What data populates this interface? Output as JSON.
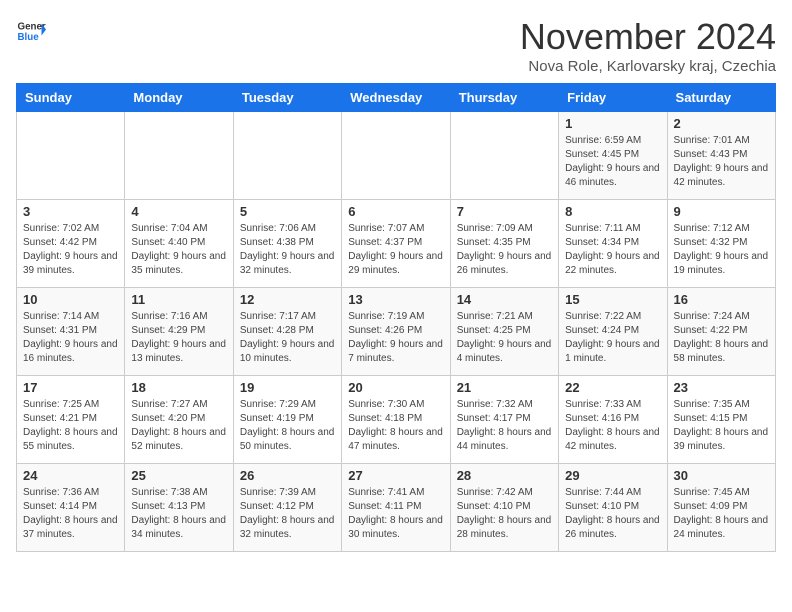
{
  "logo": {
    "line1": "General",
    "line2": "Blue"
  },
  "title": "November 2024",
  "subtitle": "Nova Role, Karlovarsky kraj, Czechia",
  "days_of_week": [
    "Sunday",
    "Monday",
    "Tuesday",
    "Wednesday",
    "Thursday",
    "Friday",
    "Saturday"
  ],
  "weeks": [
    [
      {
        "day": "",
        "info": ""
      },
      {
        "day": "",
        "info": ""
      },
      {
        "day": "",
        "info": ""
      },
      {
        "day": "",
        "info": ""
      },
      {
        "day": "",
        "info": ""
      },
      {
        "day": "1",
        "info": "Sunrise: 6:59 AM\nSunset: 4:45 PM\nDaylight: 9 hours and 46 minutes."
      },
      {
        "day": "2",
        "info": "Sunrise: 7:01 AM\nSunset: 4:43 PM\nDaylight: 9 hours and 42 minutes."
      }
    ],
    [
      {
        "day": "3",
        "info": "Sunrise: 7:02 AM\nSunset: 4:42 PM\nDaylight: 9 hours and 39 minutes."
      },
      {
        "day": "4",
        "info": "Sunrise: 7:04 AM\nSunset: 4:40 PM\nDaylight: 9 hours and 35 minutes."
      },
      {
        "day": "5",
        "info": "Sunrise: 7:06 AM\nSunset: 4:38 PM\nDaylight: 9 hours and 32 minutes."
      },
      {
        "day": "6",
        "info": "Sunrise: 7:07 AM\nSunset: 4:37 PM\nDaylight: 9 hours and 29 minutes."
      },
      {
        "day": "7",
        "info": "Sunrise: 7:09 AM\nSunset: 4:35 PM\nDaylight: 9 hours and 26 minutes."
      },
      {
        "day": "8",
        "info": "Sunrise: 7:11 AM\nSunset: 4:34 PM\nDaylight: 9 hours and 22 minutes."
      },
      {
        "day": "9",
        "info": "Sunrise: 7:12 AM\nSunset: 4:32 PM\nDaylight: 9 hours and 19 minutes."
      }
    ],
    [
      {
        "day": "10",
        "info": "Sunrise: 7:14 AM\nSunset: 4:31 PM\nDaylight: 9 hours and 16 minutes."
      },
      {
        "day": "11",
        "info": "Sunrise: 7:16 AM\nSunset: 4:29 PM\nDaylight: 9 hours and 13 minutes."
      },
      {
        "day": "12",
        "info": "Sunrise: 7:17 AM\nSunset: 4:28 PM\nDaylight: 9 hours and 10 minutes."
      },
      {
        "day": "13",
        "info": "Sunrise: 7:19 AM\nSunset: 4:26 PM\nDaylight: 9 hours and 7 minutes."
      },
      {
        "day": "14",
        "info": "Sunrise: 7:21 AM\nSunset: 4:25 PM\nDaylight: 9 hours and 4 minutes."
      },
      {
        "day": "15",
        "info": "Sunrise: 7:22 AM\nSunset: 4:24 PM\nDaylight: 9 hours and 1 minute."
      },
      {
        "day": "16",
        "info": "Sunrise: 7:24 AM\nSunset: 4:22 PM\nDaylight: 8 hours and 58 minutes."
      }
    ],
    [
      {
        "day": "17",
        "info": "Sunrise: 7:25 AM\nSunset: 4:21 PM\nDaylight: 8 hours and 55 minutes."
      },
      {
        "day": "18",
        "info": "Sunrise: 7:27 AM\nSunset: 4:20 PM\nDaylight: 8 hours and 52 minutes."
      },
      {
        "day": "19",
        "info": "Sunrise: 7:29 AM\nSunset: 4:19 PM\nDaylight: 8 hours and 50 minutes."
      },
      {
        "day": "20",
        "info": "Sunrise: 7:30 AM\nSunset: 4:18 PM\nDaylight: 8 hours and 47 minutes."
      },
      {
        "day": "21",
        "info": "Sunrise: 7:32 AM\nSunset: 4:17 PM\nDaylight: 8 hours and 44 minutes."
      },
      {
        "day": "22",
        "info": "Sunrise: 7:33 AM\nSunset: 4:16 PM\nDaylight: 8 hours and 42 minutes."
      },
      {
        "day": "23",
        "info": "Sunrise: 7:35 AM\nSunset: 4:15 PM\nDaylight: 8 hours and 39 minutes."
      }
    ],
    [
      {
        "day": "24",
        "info": "Sunrise: 7:36 AM\nSunset: 4:14 PM\nDaylight: 8 hours and 37 minutes."
      },
      {
        "day": "25",
        "info": "Sunrise: 7:38 AM\nSunset: 4:13 PM\nDaylight: 8 hours and 34 minutes."
      },
      {
        "day": "26",
        "info": "Sunrise: 7:39 AM\nSunset: 4:12 PM\nDaylight: 8 hours and 32 minutes."
      },
      {
        "day": "27",
        "info": "Sunrise: 7:41 AM\nSunset: 4:11 PM\nDaylight: 8 hours and 30 minutes."
      },
      {
        "day": "28",
        "info": "Sunrise: 7:42 AM\nSunset: 4:10 PM\nDaylight: 8 hours and 28 minutes."
      },
      {
        "day": "29",
        "info": "Sunrise: 7:44 AM\nSunset: 4:10 PM\nDaylight: 8 hours and 26 minutes."
      },
      {
        "day": "30",
        "info": "Sunrise: 7:45 AM\nSunset: 4:09 PM\nDaylight: 8 hours and 24 minutes."
      }
    ]
  ]
}
